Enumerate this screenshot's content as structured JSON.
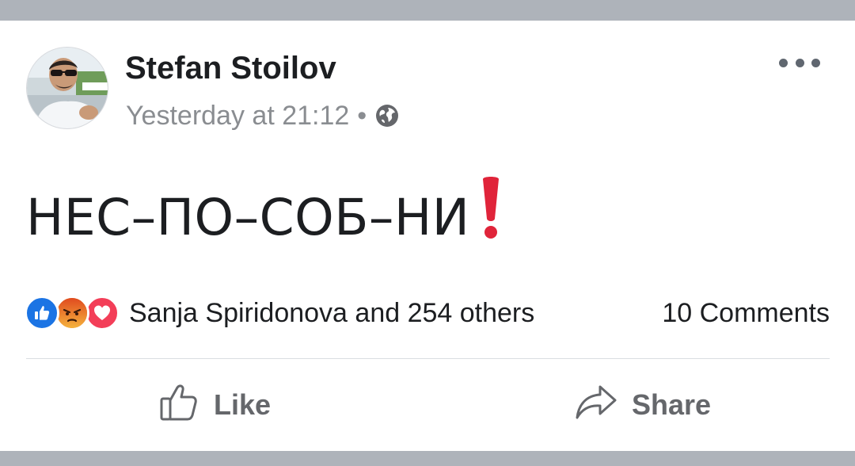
{
  "post": {
    "author": "Stefan Stoilov",
    "timestamp": "Yesterday at 21:12",
    "separator": "•",
    "audience_icon": "globe-icon",
    "text": "НЕС–ПО–СОБ–НИ",
    "text_emoji": "red-exclamation-icon",
    "more_icon": "more-horizontal-icon"
  },
  "reactions": {
    "types": [
      "like",
      "angry",
      "love"
    ],
    "summary": "Sanja Spiridonova and 254 others"
  },
  "comments": {
    "label": "10 Comments"
  },
  "actions": {
    "like_label": "Like",
    "share_label": "Share"
  },
  "colors": {
    "band": "#aeb3ba",
    "like_blue": "#1b74e4",
    "angry_orange": "#e9710f",
    "love_red": "#f33e58",
    "exclamation_red": "#e0243a",
    "meta_gray": "#8a8d91",
    "action_gray": "#65676b"
  }
}
